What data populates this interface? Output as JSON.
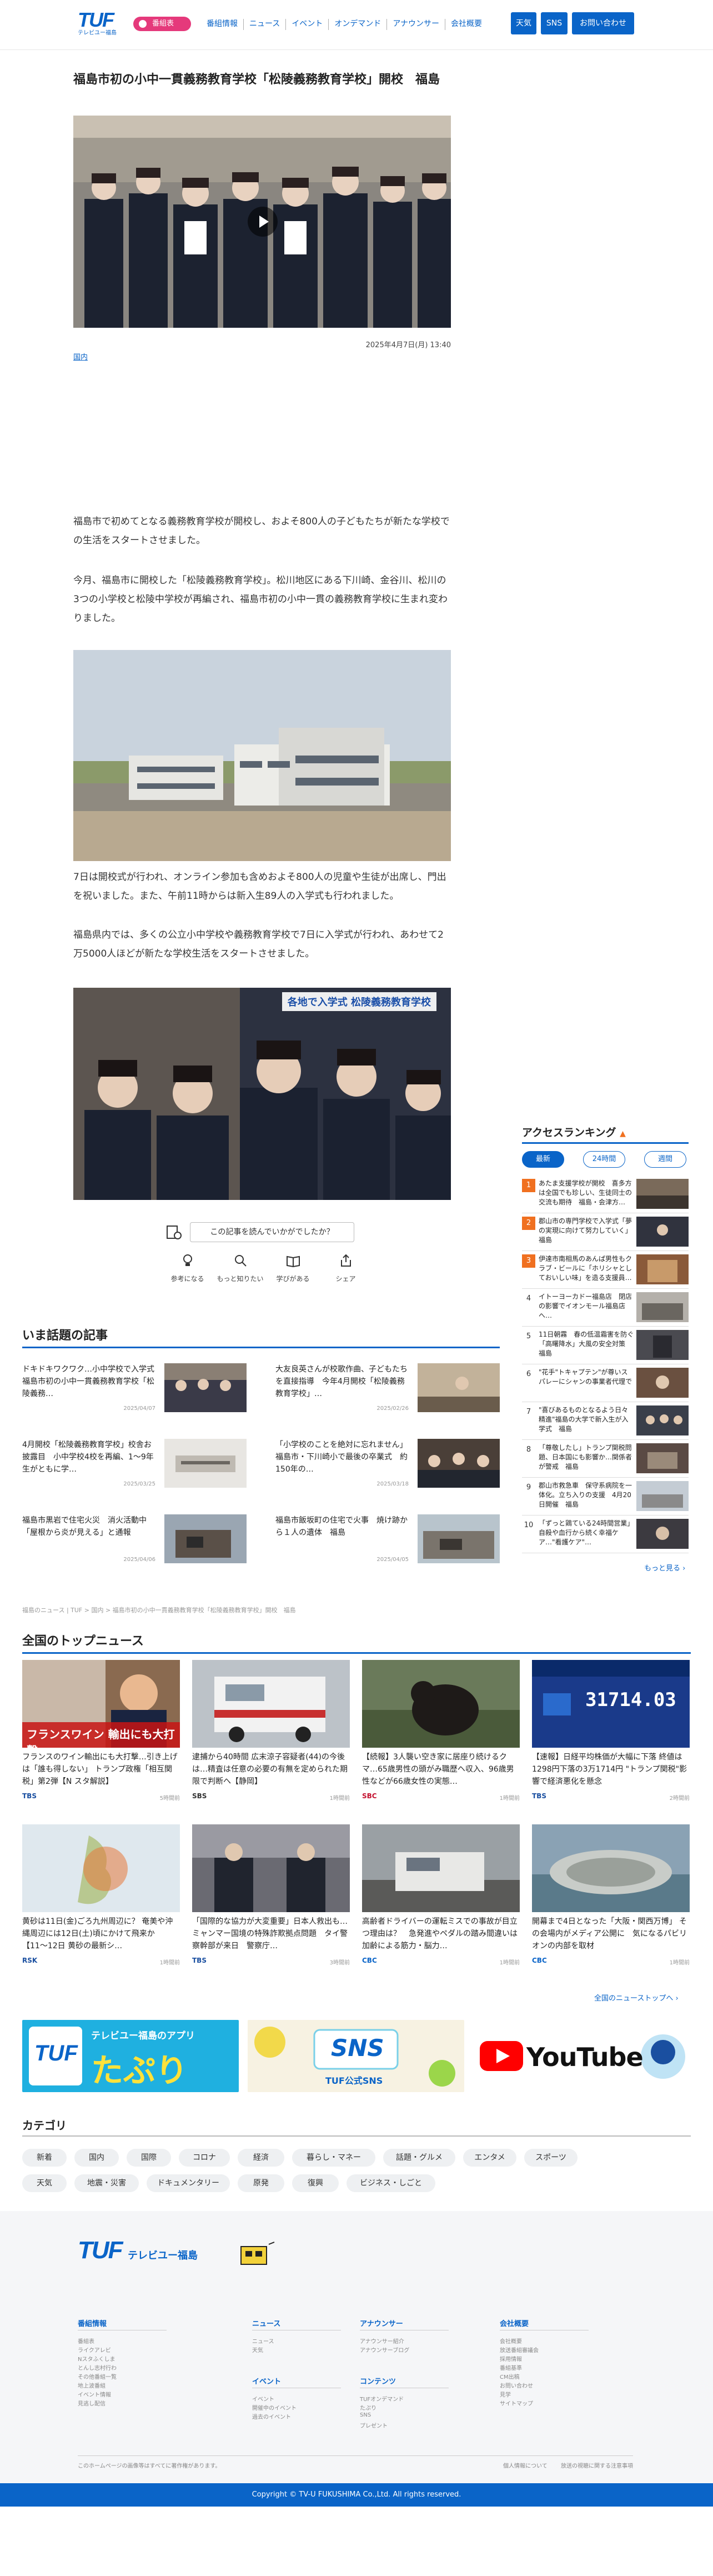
{
  "header": {
    "logo_text": "TUF",
    "logo_sub": "テレビユー福島",
    "program_badge": "番組表",
    "nav": [
      "番組情報",
      "ニュース",
      "イベント",
      "オンデマンド",
      "アナウンサー",
      "会社概要"
    ],
    "btn_weather": "天気",
    "btn_sns": "SNS",
    "btn_contact": "お問い合わせ"
  },
  "article": {
    "title": "福島市初の小中一貫義務教育学校「松陵義務教育学校」開校　福島",
    "datetime": "2025年4月7日(月) 13:40",
    "category": "国内",
    "p1": "福島市で初めてとなる義務教育学校が開校し、およそ800人の子どもたちが新たな学校での生活をスタートさせました。",
    "p2": "今月、福島市に開校した「松陵義務教育学校」。松川地区にある下川崎、金谷川、松川の3つの小学校と松陵中学校が再編され、福島市初の小中一貫の義務教育学校に生まれ変わりました。",
    "p3": "7日は開校式が行われ、オンライン参加も含めおよそ800人の児童や生徒が出席し、門出を祝いました。また、午前11時からは新入生89人の入学式も行われました。",
    "p4": "福島県内では、多くの公立小中学校や義務教育学校で7日に入学式が行われ、あわせて2万5000人ほどが新たな学校生活をスタートさせました。",
    "photo2_caption": "各地で入学式 松陵義務教育学校",
    "feedback": "この記事を読んでいかがでしたか？",
    "reactions": [
      "参考になる",
      "もっと知りたい",
      "学びがある",
      "シェア"
    ]
  },
  "trending": {
    "heading": "いま話題の記事",
    "items": [
      {
        "title": "ドキドキワクワク…小中学校で入学式　福島市初の小中一貫義務教育学校「松陵義務…",
        "date": "2025/04/07"
      },
      {
        "title": "大友良英さんが校歌作曲、子どもたちを直接指導　今年4月開校「松陵義務教育学校」…",
        "date": "2025/02/26"
      },
      {
        "title": "4月開校「松陵義務教育学校」校舎お披露目　小中学校4校を再編、1〜9年生がともに学…",
        "date": "2025/03/25"
      },
      {
        "title": "「小学校のことを絶対に忘れません」福島市・下川崎小で最後の卒業式　約150年の…",
        "date": "2025/03/18"
      },
      {
        "title": "福島市黒岩で住宅火災　消火活動中「屋根から炎が見える」と通報",
        "date": "2025/04/06"
      },
      {
        "title": "福島市飯坂町の住宅で火事　焼け跡から１人の遺体　福島",
        "date": "2025/04/05"
      }
    ]
  },
  "ranking": {
    "heading": "アクセスランキング",
    "tabs": [
      "最新",
      "24時間",
      "週間"
    ],
    "items": [
      {
        "num": "1",
        "title": "あたま支援学校が開校　喜多方は全国でも珍しい、生徒同士の交流も期待　福島・会津方…"
      },
      {
        "num": "2",
        "title": "郡山市の専門学校で入学式「夢の実現に向けて努力していく」　福島"
      },
      {
        "num": "3",
        "title": "伊達市南相馬のあんぱ男性もクラブ・ビールに「ホリシャとしておいしい味」を造る支援員…"
      },
      {
        "num": "4",
        "title": "イトーヨーカドー福島店　閉店の影響でイオンモール福島店へ…"
      },
      {
        "num": "5",
        "title": "11日朝霧　春の低温霜害を防ぐ「高曙降水」大風の安全対策　福島"
      },
      {
        "num": "6",
        "title": "\"花手\"トキャプテン\"が尊いスパレーにシャンの事業者代理で"
      },
      {
        "num": "7",
        "title": "\"喜びあるものとなるよう日々精進\"福島の大学で新入生が入学式　福島"
      },
      {
        "num": "8",
        "title": "「尊敬したし」トランプ関税問題、日本国にも影響か…関係者が警戒　福島"
      },
      {
        "num": "9",
        "title": "郡山市救急車　保守系病院を一体化。立ち入りの支援　4月20日開催　福島"
      },
      {
        "num": "10",
        "title": "「ずっと鶏ている24時間営業」自殺や血行から続く幸福ケア…\"看護ケア\"…"
      }
    ],
    "more": "もっと見る"
  },
  "breadcrumb": "福島のニュース | TUF > 国内 > 福島市初の小中一貫義務教育学校「松陵義務教育学校」開校　福島",
  "national": {
    "heading": "全国のトップニュース",
    "items": [
      {
        "title": "フランスのワイン輸出にも大打撃…引き上げは「誰も得しない」 トランプ政権「相互関税」第2弾【N スタ解説】",
        "source": "TBS",
        "date": "5時間前",
        "source_color": "#1a4fa0",
        "img_text": "フランスワイン 輸出にも大打撃"
      },
      {
        "title": "逮捕から40時間 広末涼子容疑者(44)の今後は…精査は任意の必要の有無を定められた期限で判断へ【静岡】",
        "source": "SBS",
        "date": "1時間前",
        "source_color": "#333333",
        "img_text": ""
      },
      {
        "title": "【続報】3人襲い空き家に居座り続けるクマ…65歳男性の頭がみ職歴ヘ収入、96歳男性などが66歳女性の実態…",
        "source": "SBC",
        "date": "1時間前",
        "source_color": "#c4122f",
        "img_text": ""
      },
      {
        "title": "【速報】日経平均株価が大幅に下落 終値は1298円下落の3万1714円 \"トランプ関税\"影響で経済悪化を懸念",
        "source": "TBS",
        "date": "2時間前",
        "source_color": "#1a4fa0",
        "img_text": "31714.03"
      },
      {
        "title": "黄砂は11日(金)ごろ九州周辺に？ 奄美や沖縄周辺には12日(土)頃にかけて飛来か【11〜12日 黄砂の最新シ…",
        "source": "RSK",
        "date": "1時間前",
        "source_color": "#1a4fa0",
        "img_text": ""
      },
      {
        "title": "「国際的な協力が大変重要」日本人救出も…ミャンマー国境の特殊詐欺拠点問題　タイ警察幹部が来日　警察庁…",
        "source": "TBS",
        "date": "3時間前",
        "source_color": "#1a4fa0",
        "img_text": ""
      },
      {
        "title": "高齢者ドライバーの運転ミスでの事故が目立つ理由は？　急発進やペダルの踏み間違いは加齢による筋力・脳力…",
        "source": "CBC",
        "date": "1時間前",
        "source_color": "#0a64c8",
        "img_text": ""
      },
      {
        "title": "開幕まで4日となった「大阪・関西万博」 その会場内がメディア公開に　気になるパビリオンの内部を取材",
        "source": "CBC",
        "date": "1時間前",
        "source_color": "#0a64c8",
        "img_text": ""
      }
    ],
    "more": "全国のニューストップへ"
  },
  "banners": {
    "app_title": "テレビユー福島のアプリ",
    "app_name": "たぷり",
    "sns_title": "TUF公式SNS",
    "youtube": "YouTube"
  },
  "categories": {
    "heading": "カテゴリ",
    "items": [
      "新着",
      "国内",
      "国際",
      "コロナ",
      "経済",
      "暮らし・マネー",
      "話題・グルメ",
      "エンタメ",
      "スポーツ",
      "天気",
      "地震・災害",
      "ドキュメンタリー",
      "原発",
      "復興",
      "ビジネス・しごと"
    ]
  },
  "footer": {
    "logo": "TUF",
    "logo_sub": "テレビユー福島",
    "cols": [
      {
        "heading": "番組情報",
        "links": [
          "番組表",
          "ライクアレビ",
          "Nスタふくしま",
          "とんし志村行わ",
          "その他番組一覧",
          "地上波番組",
          "イベント情報",
          "見逃し配信"
        ]
      },
      {
        "heading": "ニュース",
        "links": [
          "ニュース",
          "天気"
        ]
      },
      {
        "heading": "イベント",
        "links": [
          "イベント",
          "開催中のイベント",
          "過去のイベント"
        ]
      },
      {
        "heading": "アナウンサー",
        "links": [
          "アナウンサー紹介",
          "アナウンサーブログ"
        ]
      },
      {
        "heading": "コンテンツ",
        "links": [
          "TUFオンデマンド",
          "たぷり",
          "SNS",
          "プレゼント"
        ]
      },
      {
        "heading": "会社概要",
        "links": [
          "会社概要",
          "放送番組審議会",
          "採用情報",
          "番組基準",
          "CM出稿",
          "お問い合わせ",
          "見学",
          "サイトマップ"
        ]
      }
    ],
    "note": "このホームページの画像等はすべてに著作権があります。",
    "policy_links": [
      "個人情報について",
      "放送の視聴に関する注意事項"
    ],
    "copyright": "Copyright © TV-U FUKUSHIMA Co.,Ltd. All rights reserved."
  },
  "colors": {
    "brand": "#0a64c8",
    "accent": "#e5397b",
    "rank_top": "#f07020"
  }
}
